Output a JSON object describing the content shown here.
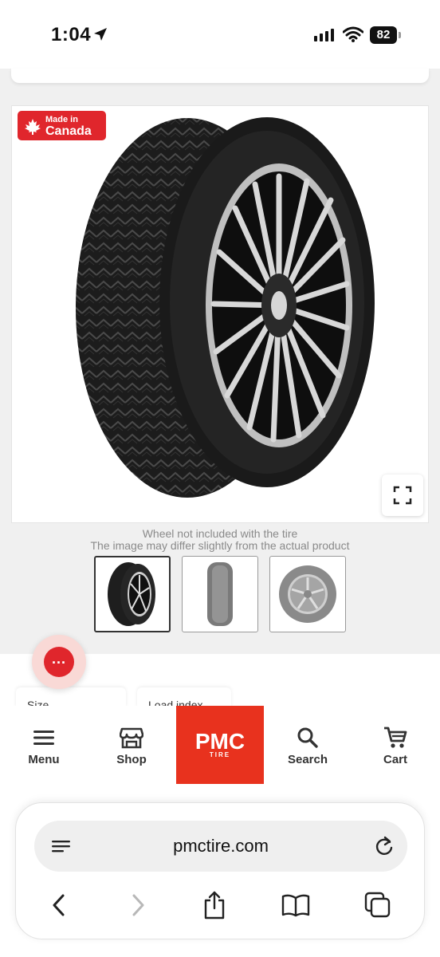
{
  "status_bar": {
    "time": "1:04",
    "battery": "82"
  },
  "product": {
    "badge": {
      "line1": "Made in",
      "line2": "Canada"
    },
    "notice_line1": "Wheel not included with the tire",
    "notice_line2": "The image may differ slightly from the actual product",
    "thumbnails": [
      "tire-with-wheel",
      "tire-tread-view",
      "tire-side-view"
    ]
  },
  "specs": {
    "size_label": "Size",
    "load_index_label": "Load index"
  },
  "bottom_nav": {
    "menu": "Menu",
    "shop": "Shop",
    "logo_main": "PMC",
    "logo_sub": "TIRE",
    "search": "Search",
    "cart": "Cart"
  },
  "browser": {
    "url": "pmctire.com"
  },
  "colors": {
    "brand_red": "#e8321e",
    "badge_red": "#e0262c",
    "chat_red": "#e0262c"
  }
}
